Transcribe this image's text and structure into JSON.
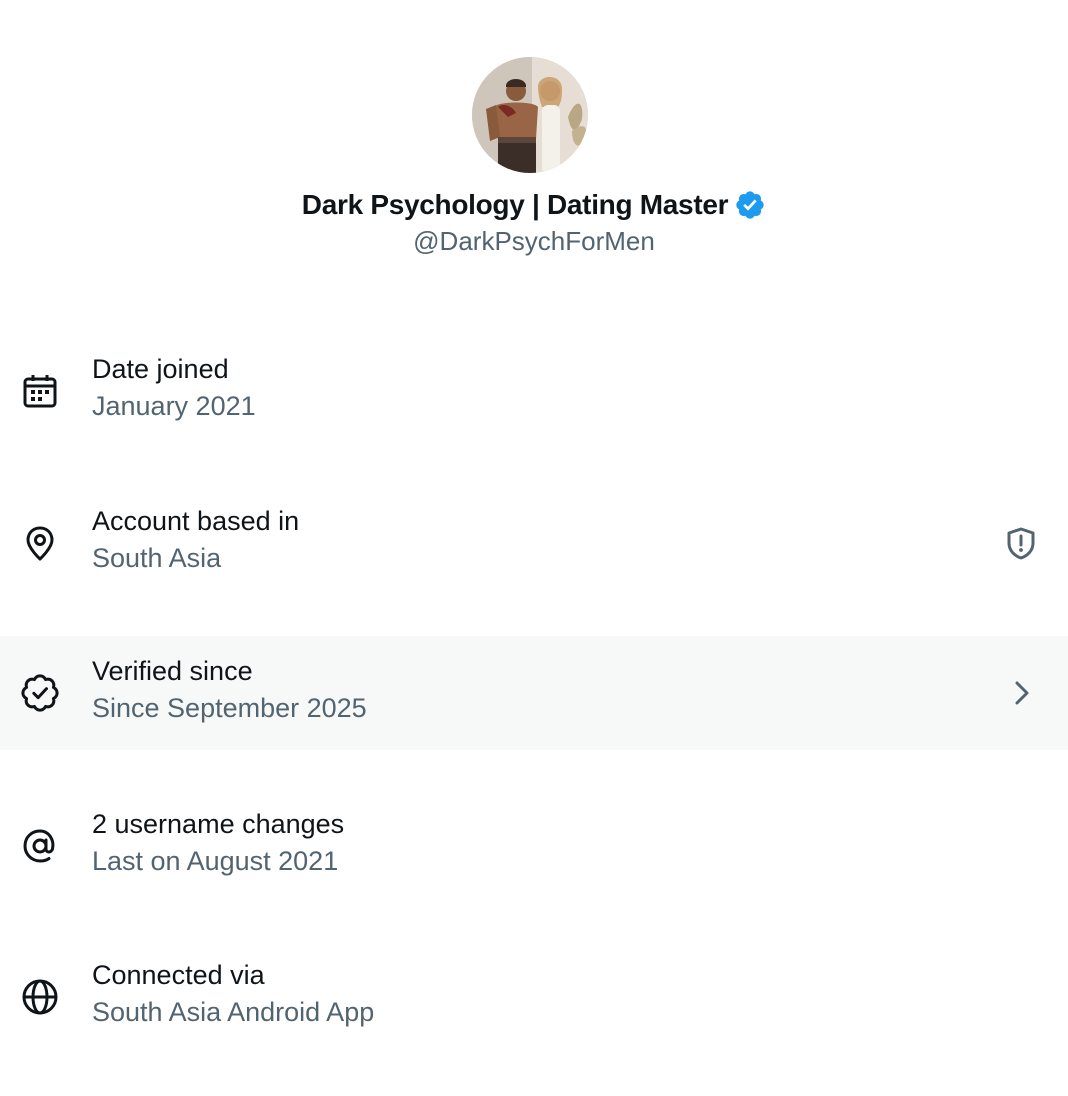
{
  "profile": {
    "display_name": "Dark Psychology | Dating Master",
    "handle": "@DarkPsychForMen",
    "verified_badge": "verified-check-icon",
    "verified_color": "#1d9bf0"
  },
  "rows": [
    {
      "icon": "calendar-icon",
      "title": "Date joined",
      "subtitle": "January 2021"
    },
    {
      "icon": "location-pin-icon",
      "title": "Account based in",
      "subtitle": "South Asia",
      "trailing_icon": "shield-alert-icon"
    },
    {
      "icon": "verified-badge-icon",
      "title": "Verified since",
      "subtitle": "Since September 2025",
      "trailing_icon": "chevron-right-icon",
      "highlighted": true
    },
    {
      "icon": "at-sign-icon",
      "title": "2 username changes",
      "subtitle": "Last on August 2021"
    },
    {
      "icon": "globe-icon",
      "title": "Connected via",
      "subtitle": "South Asia Android App"
    }
  ],
  "colors": {
    "primary_text": "#0f1419",
    "secondary_text": "#536471",
    "highlight_background": "#f7f9f9"
  }
}
